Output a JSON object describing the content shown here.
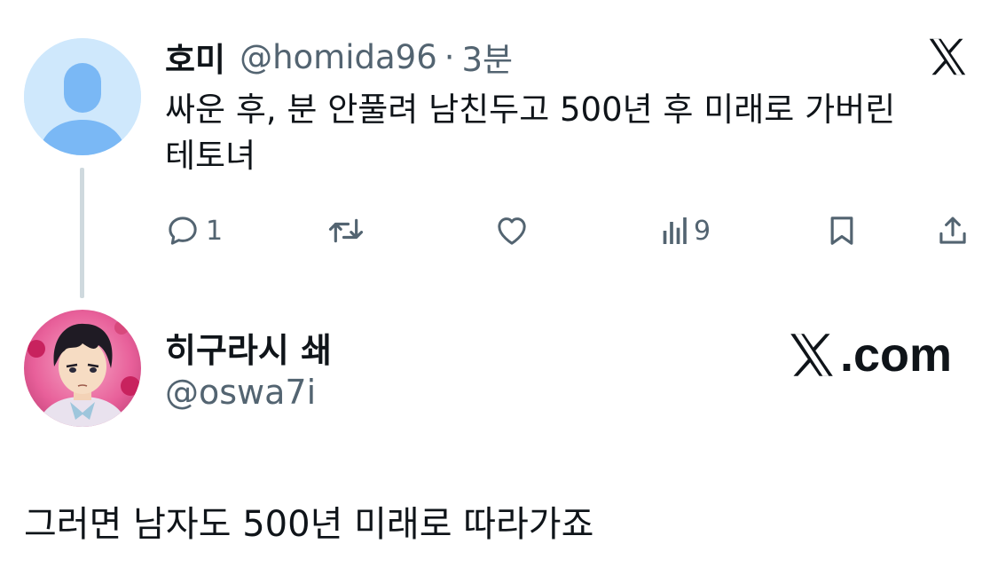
{
  "tweet": {
    "display_name": "호미",
    "handle": "@homida96",
    "separator": "·",
    "time": "3분",
    "text": "싸운 후, 분 안풀려 남친두고 500년 후 미래로 가버린 테토녀",
    "actions": {
      "reply_count": "1",
      "views_count": "9"
    }
  },
  "profile_card": {
    "display_name": "히구라시 쇄",
    "handle": "@oswa7i",
    "watermark_text": ".com"
  },
  "reply": {
    "text": "그러면 남자도 500년 미래로 따라가죠"
  },
  "icons": {
    "brand": "x-logo-icon",
    "reply": "speech-bubble-icon",
    "retweet": "retweet-icon",
    "like": "heart-icon",
    "views": "bar-chart-icon",
    "bookmark": "bookmark-icon",
    "share": "share-upload-icon"
  },
  "colors": {
    "text_primary": "#0f1419",
    "text_secondary": "#536471",
    "thread_line": "#cfd9de",
    "default_avatar_bg": "#cfe8fc",
    "default_avatar_fg": "#7ab8f5"
  }
}
